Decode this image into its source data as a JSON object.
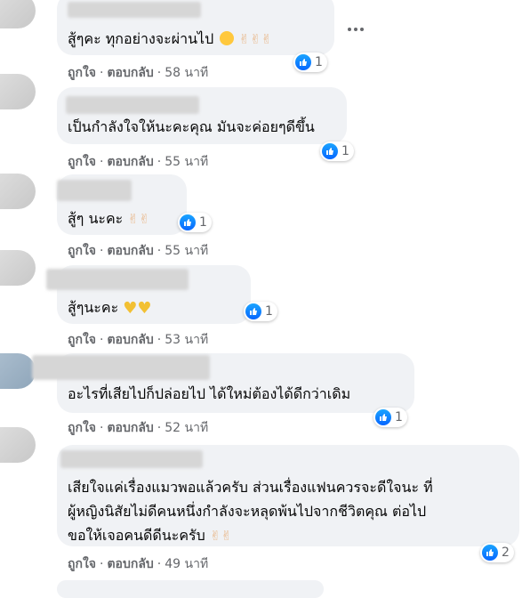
{
  "comments": [
    {
      "text": "สู้ๆคะ ทุกอย่างจะผ่านไป",
      "emoji": "😊✌✌✌",
      "reaction_count": "1",
      "like": "ถูกใจ",
      "reply": "ตอบกลับ",
      "time": "58 นาที"
    },
    {
      "text": "เป็นกำลังใจให้นะคะคุณ มันจะค่อยๆดีขึ้น",
      "emoji": "",
      "reaction_count": "1",
      "like": "ถูกใจ",
      "reply": "ตอบกลับ",
      "time": "55 นาที"
    },
    {
      "text": "สู้ๆ นะคะ",
      "emoji": "✌✌",
      "reaction_count": "1",
      "like": "ถูกใจ",
      "reply": "ตอบกลับ",
      "time": "55 นาที"
    },
    {
      "text": "สู้ๆนะคะ",
      "emoji": "💛💛",
      "reaction_count": "1",
      "like": "ถูกใจ",
      "reply": "ตอบกลับ",
      "time": "53 นาที"
    },
    {
      "text": "อะไรที่เสียไปก็ปล่อยไป ได้ใหม่ต้องได้ดีกว่าเดิม",
      "emoji": "",
      "reaction_count": "1",
      "like": "ถูกใจ",
      "reply": "ตอบกลับ",
      "time": "52 นาที"
    },
    {
      "lines": [
        "เสียใจแค่เรื่องแมวพอแล้วครับ ส่วนเรื่องแฟนควรจะดีใจนะ ที่",
        "ผู้หญิงนิสัยไม่ดีคนหนึ่งกำลังจะหลุดพ้นไปจากชีวิตคุณ ต่อไป",
        "ขอให้เจอคนดีดีนะครับ"
      ],
      "emoji": "✌✌",
      "reaction_count": "2",
      "like": "ถูกใจ",
      "reply": "ตอบกลับ",
      "time": "49 นาที"
    }
  ],
  "separator": "·",
  "icons": {
    "like_reaction": "like-thumb-icon",
    "more": "more-options-icon"
  },
  "colors": {
    "bubble": "#f0f2f5",
    "like_blue": "#0866ff",
    "meta_text": "#65676b"
  }
}
